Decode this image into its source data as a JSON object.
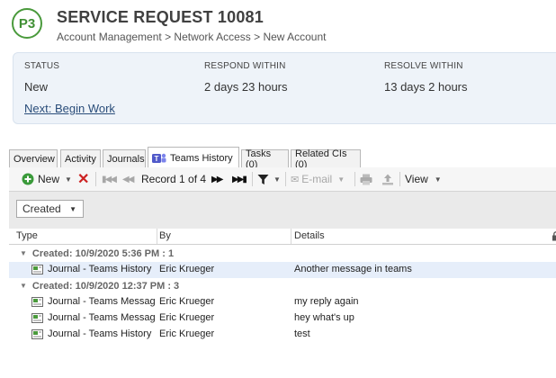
{
  "header": {
    "priority": "P3",
    "title": "SERVICE REQUEST 10081",
    "breadcrumb": "Account Management > Network Access > New Account"
  },
  "status_panel": {
    "status_label": "STATUS",
    "status_value": "New",
    "respond_label": "RESPOND WITHIN",
    "respond_value": "2 days 23 hours",
    "resolve_label": "RESOLVE WITHIN",
    "resolve_value": "13 days 2 hours",
    "next_action": "Next: Begin Work"
  },
  "tabs": [
    {
      "label": "Overview"
    },
    {
      "label": "Activity"
    },
    {
      "label": "Journals"
    },
    {
      "label": "Teams History",
      "active": true
    },
    {
      "label": "Tasks (0)"
    },
    {
      "label": "Related CIs (0)"
    }
  ],
  "toolbar": {
    "new_label": "New",
    "record_label": "Record 1 of 4",
    "email_label": "E-mail",
    "view_label": "View"
  },
  "group_by": {
    "selected": "Created"
  },
  "grid": {
    "columns": [
      "Type",
      "By",
      "Details"
    ],
    "groups": [
      {
        "label": "Created: 10/9/2020 5:36 PM : 1",
        "rows": [
          {
            "type": "Journal - Teams History",
            "by": "Eric Krueger",
            "details": "Another message in teams"
          }
        ]
      },
      {
        "label": "Created: 10/9/2020 12:37 PM : 3",
        "rows": [
          {
            "type": "Journal - Teams Messag",
            "by": "Eric Krueger",
            "details": "my reply again"
          },
          {
            "type": "Journal - Teams Messag",
            "by": "Eric Krueger",
            "details": "hey what's up"
          },
          {
            "type": "Journal - Teams History",
            "by": "Eric Krueger",
            "details": "test"
          }
        ]
      }
    ]
  },
  "colors": {
    "accent_green": "#4a9a3c",
    "link_blue": "#2a4d7a",
    "delete_red": "#cc2222",
    "selected_row": "#e6eefa"
  }
}
